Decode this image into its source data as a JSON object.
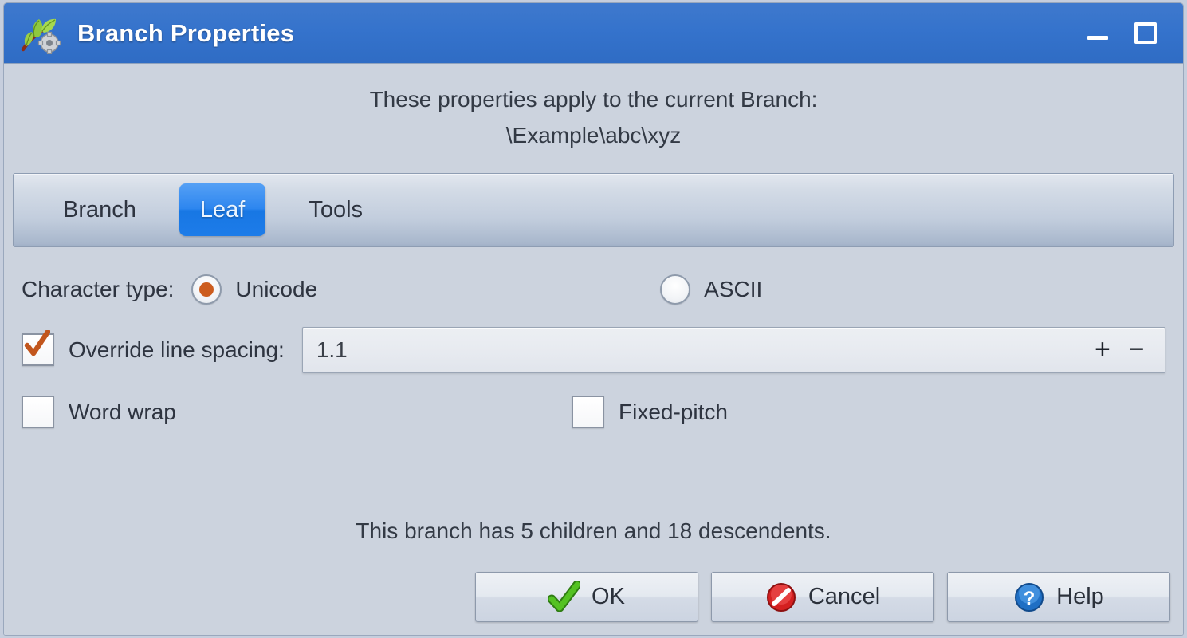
{
  "window": {
    "title": "Branch Properties",
    "app_icon": "leaf-gear-icon",
    "controls": {
      "minimize": "Minimize",
      "maximize": "Maximize"
    },
    "titlebar_color": "#3573cc"
  },
  "intro": {
    "line1": "These properties apply to the current Branch:",
    "line2": "\\Example\\abc\\xyz"
  },
  "tabs": [
    {
      "label": "Branch",
      "selected": false
    },
    {
      "label": "Leaf",
      "selected": true
    },
    {
      "label": "Tools",
      "selected": false
    }
  ],
  "form": {
    "character_type": {
      "label": "Character type:",
      "options": [
        {
          "label": "Unicode",
          "selected": true
        },
        {
          "label": "ASCII",
          "selected": false
        }
      ],
      "accent_color": "#cc5c1e"
    },
    "line_spacing": {
      "checkbox_label": "Override line spacing:",
      "checked": true,
      "value": "1.1",
      "increment_label": "+",
      "decrement_label": "−"
    },
    "word_wrap": {
      "label": "Word wrap",
      "checked": false
    },
    "fixed_pitch": {
      "label": "Fixed-pitch",
      "checked": false
    }
  },
  "info": {
    "text": "This branch has 5 children and 18 descendents."
  },
  "buttons": [
    {
      "label": "OK",
      "icon": "green-check-icon"
    },
    {
      "label": "Cancel",
      "icon": "red-forbidden-icon"
    },
    {
      "label": "Help",
      "icon": "blue-question-icon"
    }
  ]
}
